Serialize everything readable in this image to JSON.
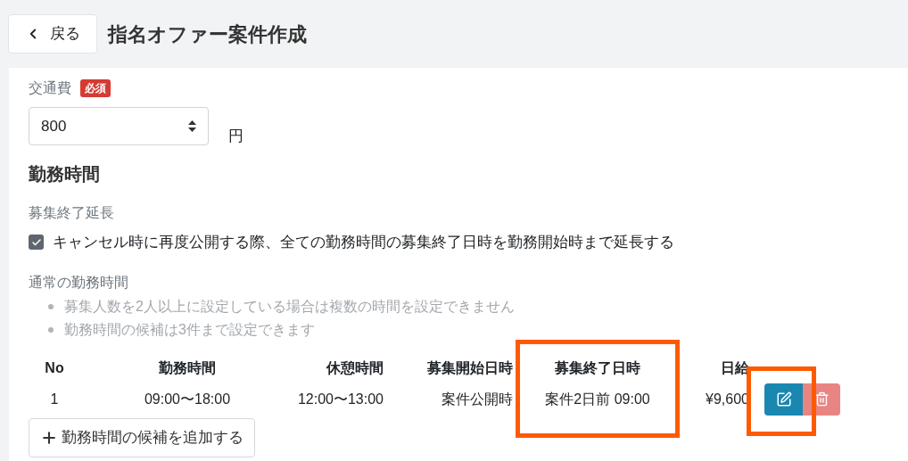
{
  "header": {
    "back_label": "戻る",
    "title": "指名オファー案件作成"
  },
  "fee": {
    "label": "交通費",
    "badge": "必須",
    "value": "800",
    "unit": "円"
  },
  "section_title": "勤務時間",
  "extension": {
    "label": "募集終了延長",
    "checkbox": {
      "label": "キャンセル時に再度公開する際、全ての勤務時間の募集終了日時を勤務開始時まで延長する",
      "checked": true
    }
  },
  "normal": {
    "label": "通常の勤務時間",
    "notes": [
      "募集人数を2人以上に設定している場合は複数の時間を設定できません",
      "勤務時間の候補は3件まで設定できます"
    ]
  },
  "table": {
    "columns": [
      "No",
      "勤務時間",
      "休憩時間",
      "募集開始日時",
      "募集終了日時",
      "日給"
    ],
    "rows": [
      {
        "cells": [
          "1",
          "09:00〜18:00",
          "12:00〜13:00",
          "案件公開時",
          "案件2日前 09:00",
          "¥9,600"
        ],
        "edit_disabled": false,
        "delete_disabled": true
      }
    ]
  },
  "add_button": "勤務時間の候補を追加する",
  "highlights": {
    "end_date_column": true,
    "edit_button": true
  }
}
